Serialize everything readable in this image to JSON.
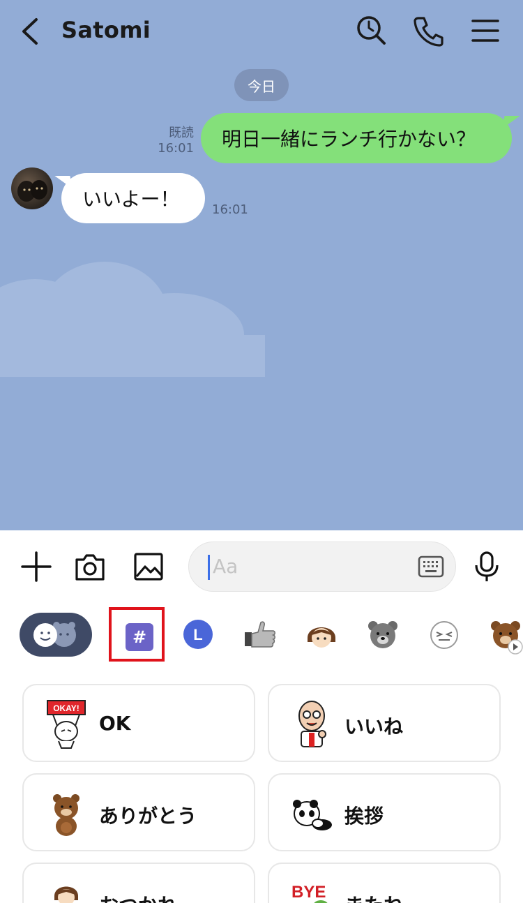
{
  "header": {
    "title": "Satomi",
    "icons": [
      "back-chevron-icon",
      "search-icon",
      "phone-icon",
      "menu-icon"
    ]
  },
  "chat": {
    "date_label": "今日",
    "messages": [
      {
        "from": "me",
        "text": "明日一緒にランチ行かない？",
        "read_label": "既読",
        "time": "16:01"
      },
      {
        "from": "them",
        "text": "いいよー！",
        "time": "16:01"
      }
    ]
  },
  "composer": {
    "placeholder": "Aa",
    "icons": [
      "plus-icon",
      "camera-icon",
      "image-icon",
      "keyboard-icon",
      "microphone-icon"
    ]
  },
  "sticker_tabs": {
    "selected": "hashtag",
    "hashtag_symbol": "#",
    "clock_symbol": "L",
    "items": [
      "emoji-toggle",
      "hashtag",
      "recent",
      "thumbs-up",
      "girl",
      "bear",
      "face",
      "brown"
    ]
  },
  "tags": [
    {
      "label": "OK",
      "sticker": "okay-sign-sticker",
      "sticker_text": "OKAY!"
    },
    {
      "label": "いいね",
      "sticker": "old-man-sticker"
    },
    {
      "label": "ありがとう",
      "sticker": "bear-sticker"
    },
    {
      "label": "挨拶",
      "sticker": "panda-sticker"
    },
    {
      "label": "おつかれ",
      "sticker": "girl-sticker"
    },
    {
      "label": "またね",
      "sticker": "bye-sticker",
      "sticker_text": "BYE"
    }
  ],
  "colors": {
    "chat_bg": "#92acd6",
    "my_bubble": "#84e07a",
    "their_bubble": "#ffffff",
    "highlight": "#e0131b",
    "hashtag_bg": "#6b63c7"
  }
}
